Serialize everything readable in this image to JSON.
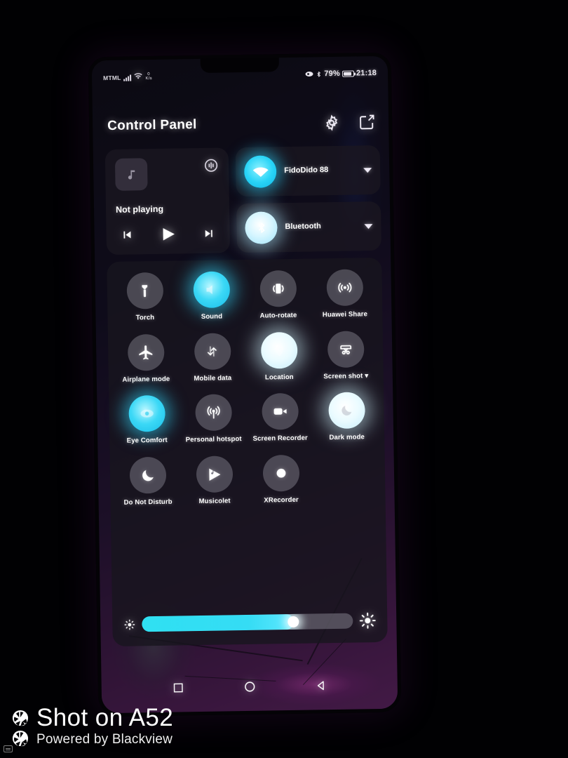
{
  "statusbar": {
    "carrier": "MTML",
    "signal_icon": "signal-bars-icon",
    "wifi_icon": "wifi-icon",
    "netspeed_value": "0",
    "netspeed_unit": "K/s",
    "eyecomfort_icon": "eye-comfort-icon",
    "bluetooth_icon": "bluetooth-icon",
    "battery_percent": "79%",
    "battery_icon": "battery-icon",
    "clock": "21:18"
  },
  "header": {
    "title": "Control Panel",
    "settings_icon": "gear-icon",
    "edit_icon": "edit-square-icon"
  },
  "media": {
    "thumb_icon": "music-note-icon",
    "cast_icon": "audio-output-icon",
    "status": "Not playing",
    "prev_icon": "skip-previous-icon",
    "play_icon": "play-icon",
    "next_icon": "skip-next-icon"
  },
  "connections": [
    {
      "name": "wifi",
      "icon": "wifi-icon",
      "label": "FidoDido 88",
      "state": "on",
      "bubble": "cyan",
      "caret_icon": "chevron-down-icon"
    },
    {
      "name": "bluetooth",
      "icon": "bluetooth-icon",
      "label": "Bluetooth",
      "state": "on",
      "bubble": "white",
      "caret_icon": "chevron-down-icon"
    }
  ],
  "toggles": [
    [
      {
        "label": "Torch",
        "icon": "flashlight-icon",
        "state": "off"
      },
      {
        "label": "Sound",
        "icon": "sound-icon",
        "state": "on",
        "bubble": "cyan"
      },
      {
        "label": "Auto-rotate",
        "icon": "auto-rotate-icon",
        "state": "off"
      },
      {
        "label": "Huawei Share",
        "icon": "huawei-share-icon",
        "state": "off"
      }
    ],
    [
      {
        "label": "Airplane mode",
        "icon": "airplane-icon",
        "state": "off"
      },
      {
        "label": "Mobile data",
        "icon": "mobile-data-icon",
        "state": "off"
      },
      {
        "label": "Location",
        "icon": "location-icon",
        "state": "on",
        "bubble": "white"
      },
      {
        "label": "Screen shot",
        "icon": "screenshot-icon",
        "state": "off",
        "has_dropdown": true,
        "caret_icon": "chevron-down-icon"
      }
    ],
    [
      {
        "label": "Eye Comfort",
        "icon": "eye-comfort-icon",
        "state": "on",
        "bubble": "cyan"
      },
      {
        "label": "Personal hotspot",
        "icon": "hotspot-icon",
        "state": "off"
      },
      {
        "label": "Screen Recorder",
        "icon": "video-camera-icon",
        "state": "off"
      },
      {
        "label": "Dark mode",
        "icon": "dark-mode-icon",
        "state": "on",
        "bubble": "white"
      }
    ],
    [
      {
        "label": "Do Not Disturb",
        "icon": "moon-icon",
        "state": "off"
      },
      {
        "label": "Musicolet",
        "icon": "musicolet-icon",
        "state": "off"
      },
      {
        "label": "XRecorder",
        "icon": "record-dot-icon",
        "state": "off"
      },
      {
        "label": "",
        "icon": "",
        "state": "empty"
      }
    ]
  ],
  "brightness": {
    "low_icon": "brightness-low-icon",
    "high_icon": "brightness-high-icon",
    "value_percent": 72
  },
  "navbar": {
    "recents_icon": "square-recents-icon",
    "home_icon": "circle-home-icon",
    "back_icon": "triangle-back-icon"
  },
  "watermark": {
    "main": "Shot on A52",
    "sub": "Powered by Blackview",
    "icon": "camera-aperture-icon"
  },
  "colors": {
    "accent_cyan": "#2fe0f2",
    "wallpaper_magenta": "#ec42dc",
    "panel_bg": "#181520",
    "text": "#ffffff"
  }
}
